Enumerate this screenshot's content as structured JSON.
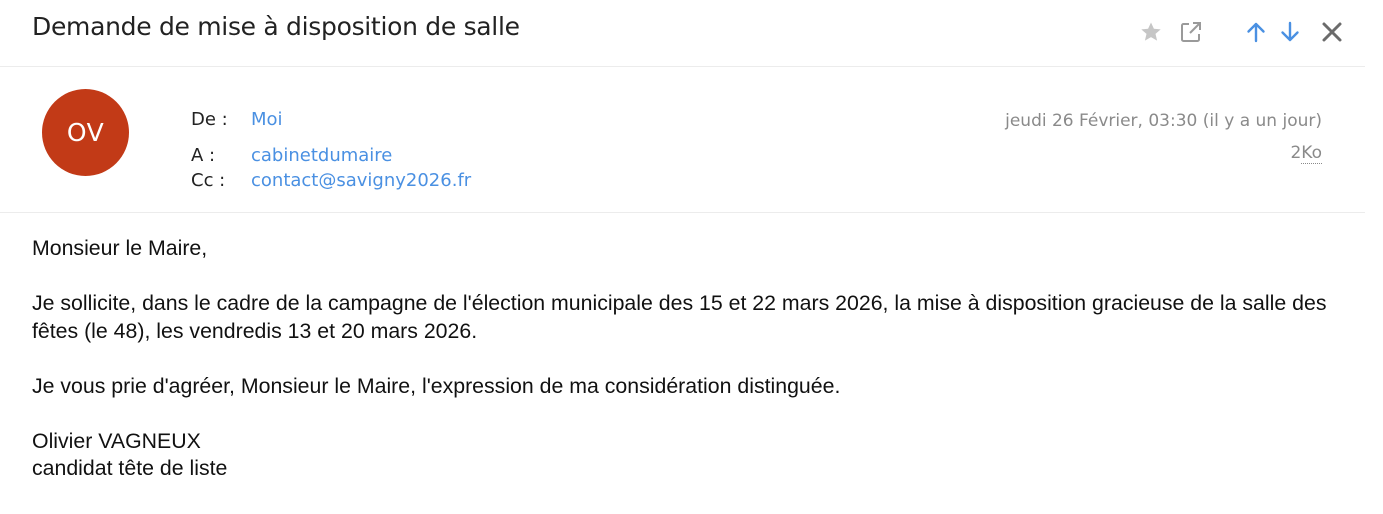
{
  "message": {
    "subject": "Demande de mise à disposition de salle",
    "sender_initials": "OV",
    "labels": {
      "from": "De :",
      "to": "A :",
      "cc": "Cc :"
    },
    "from": "Moi",
    "to": "cabinetdumaire",
    "cc": "contact@savigny2026.fr",
    "date": "jeudi 26 Février, 03:30 (il y a un jour)",
    "size_value": "2",
    "size_unit": "Ko"
  },
  "toolbar": {
    "icons": [
      "star-icon",
      "open-external-icon",
      "arrow-up-icon",
      "arrow-down-icon",
      "close-icon"
    ]
  },
  "body": {
    "greeting": "Monsieur le Maire,",
    "paragraph1": "Je sollicite, dans le cadre de la campagne de l'élection municipale des 15 et 22 mars 2026, la mise à disposition gracieuse de la salle des fêtes (le 48), les vendredis 13 et 20 mars 2026.",
    "paragraph2": "Je vous prie d'agréer, Monsieur le Maire, l'expression de ma considération distinguée.",
    "signature_name": "Olivier VAGNEUX",
    "signature_title": "candidat tête de liste"
  },
  "colors": {
    "avatar": "#c23a17",
    "link": "#4a90e2",
    "icon_gray": "#c6c6c6",
    "icon_dark": "#6b6b6b",
    "text_muted": "#8a8a8a"
  }
}
